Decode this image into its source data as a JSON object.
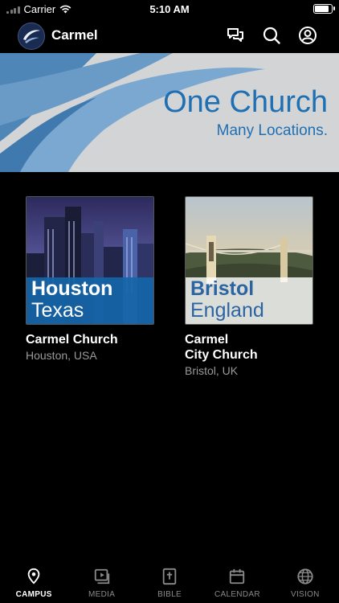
{
  "status_bar": {
    "carrier": "Carrier",
    "time": "5:10 AM"
  },
  "header": {
    "logo_text": "carmel",
    "title": "Carmel",
    "icons": [
      "chat-icon",
      "search-icon",
      "profile-icon"
    ]
  },
  "banner": {
    "headline": "One Church",
    "subline": "Many Locations.",
    "accent_color": "#1f6fb3"
  },
  "campuses": [
    {
      "overlay_city": "Houston",
      "overlay_region": "Texas",
      "name": "Carmel Church",
      "location": "Houston, USA",
      "overlay_color": "#1565a8"
    },
    {
      "overlay_city": "Bristol",
      "overlay_region": "England",
      "name_line1": "Carmel",
      "name_line2": "City Church",
      "location": "Bristol, UK",
      "overlay_color": "#ffffff"
    }
  ],
  "tabs": [
    {
      "label": "CAMPUS",
      "icon": "map-pin-icon",
      "active": true
    },
    {
      "label": "MEDIA",
      "icon": "play-icon"
    },
    {
      "label": "BIBLE",
      "icon": "bible-icon"
    },
    {
      "label": "CALENDAR",
      "icon": "calendar-icon"
    },
    {
      "label": "VISION",
      "icon": "globe-icon"
    }
  ]
}
